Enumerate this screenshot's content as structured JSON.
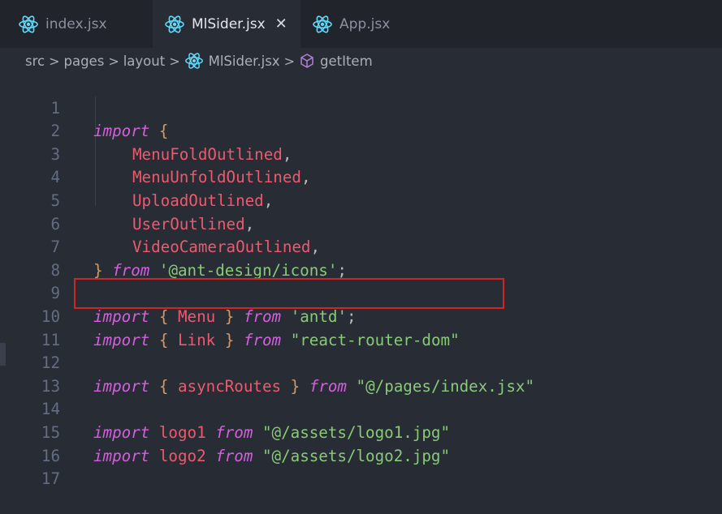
{
  "tabs": [
    {
      "label": "index.jsx",
      "icon": "react-icon",
      "active": false
    },
    {
      "label": "MlSider.jsx",
      "icon": "react-icon",
      "active": true,
      "close": "✕"
    },
    {
      "label": "App.jsx",
      "icon": "react-icon",
      "active": false
    }
  ],
  "breadcrumb": {
    "seg1": "src",
    "seg2": "pages",
    "seg3": "layout",
    "file": "MlSider.jsx",
    "symbol": "getItem",
    "separator": ">"
  },
  "editor": {
    "line_numbers": [
      "1",
      "2",
      "3",
      "4",
      "5",
      "6",
      "7",
      "8",
      "9",
      "10",
      "11",
      "12",
      "13",
      "14",
      "15",
      "16",
      "17"
    ],
    "tokens": {
      "import": "import",
      "from": "from",
      "brace_open": "{",
      "brace_close": "}",
      "comma": ",",
      "semicolon": ";",
      "MenuFoldOutlined": "MenuFoldOutlined",
      "MenuUnfoldOutlined": "MenuUnfoldOutlined",
      "UploadOutlined": "UploadOutlined",
      "UserOutlined": "UserOutlined",
      "VideoCameraOutlined": "VideoCameraOutlined",
      "ant_icons_path": "'@ant-design/icons'",
      "Menu": "Menu",
      "antd_path": "'antd'",
      "Link": "Link",
      "router_path": "\"react-router-dom\"",
      "asyncRoutes": "asyncRoutes",
      "pages_path": "\"@/pages/index.jsx\"",
      "logo1": "logo1",
      "logo1_path": "\"@/assets/logo1.jpg\"",
      "logo2": "logo2",
      "logo2_path": "\"@/assets/logo2.jpg\""
    }
  },
  "colors": {
    "background": "#282c34",
    "tabbar": "#21252b",
    "keyword": "#d55fde",
    "identifier": "#ef596f",
    "string": "#89ca78",
    "bracket": "#d19a66",
    "highlight_box": "#d02628",
    "react_icon": "#61dafb",
    "symbol_icon": "#b180d7"
  }
}
